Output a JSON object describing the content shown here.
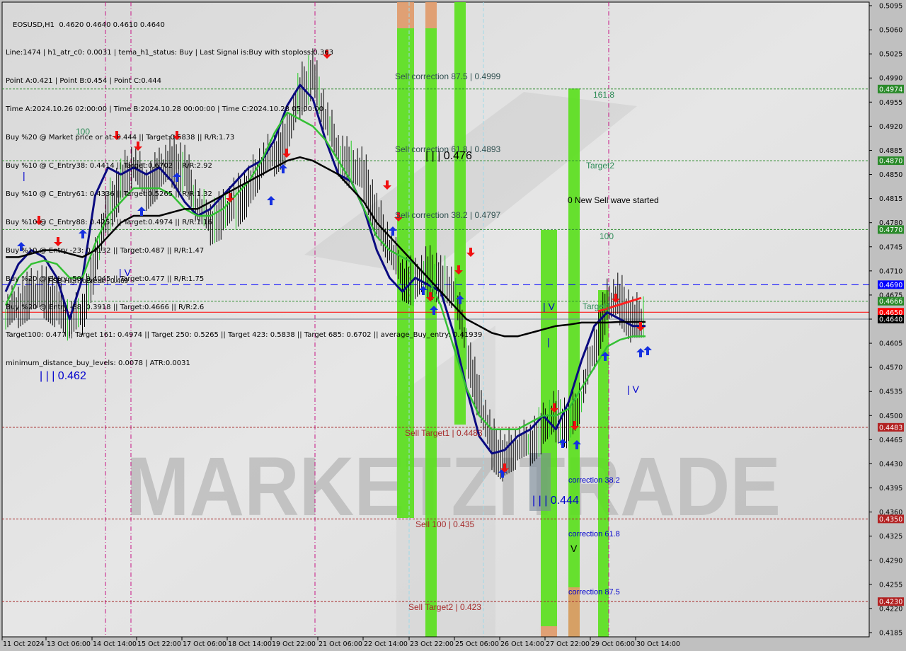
{
  "header": {
    "title": "EOSUSD,H1  0.4620 0.4640 0.4610 0.4640",
    "lines": [
      "Line:1474 | h1_atr_c0: 0.0031 | tema_h1_status: Buy | Last Signal is:Buy with stoploss:0.363",
      "Point A:0.421 | Point B:0.454 | Point C:0.444",
      "Time A:2024.10.26 02:00:00 | Time B:2024.10.28 00:00:00 | Time C:2024.10.28 05:00:00",
      "Buy %20 @ Market price or at: 0.444 || Target:0.5838 || R/R:1.73",
      "Buy %10 @ C_Entry38: 0.4414 || Target:0.6702 || R/R:2.92",
      "Buy %10 @ C_Entry61: 0.4336 || Target:0.5265 || R/R:1.32",
      "Buy %10 @ C_Entry88: 0.4251 || Target:0.4974 || R/R:1.16",
      "Buy %10 @ Entry -23: 0.4132 || Target:0.487 || R/R:1.47",
      "Buy %20 @ Entry -50: 0.4045 || Target:0.477 || R/R:1.75",
      "Buy %20 @ Entry -88: 0.3918 || Target:0.4666 || R/R:2.6",
      "Target100: 0.477 || Target 161: 0.4974 || Target 250: 0.5265 || Target 423: 0.5838 || Target 685: 0.6702 || average_Buy_entry: 0.41939",
      "minimum_distance_buy_levels: 0.0078 | ATR:0.0031"
    ]
  },
  "watermark": "MARKETZITRADE",
  "chart_data": {
    "type": "line",
    "title": "EOSUSD,H1",
    "symbol": "EOSUSD",
    "timeframe": "H1",
    "ohlc_last": {
      "open": 0.462,
      "high": 0.464,
      "low": 0.461,
      "close": 0.464
    },
    "ylim": [
      0.417,
      0.511
    ],
    "yticks": [
      "0.5095",
      "0.5060",
      "0.5025",
      "0.4990",
      "0.4955",
      "0.4920",
      "0.4885",
      "0.4850",
      "0.4815",
      "0.4780",
      "0.4745",
      "0.4710",
      "0.4675",
      "0.4640",
      "0.4605",
      "0.4570",
      "0.4535",
      "0.4500",
      "0.4465",
      "0.4430",
      "0.4395",
      "0.4360",
      "0.4325",
      "0.4290",
      "0.4255",
      "0.4220",
      "0.4185"
    ],
    "xticks": [
      "11 Oct 2024",
      "13 Oct 06:00",
      "14 Oct 14:00",
      "15 Oct 22:00",
      "17 Oct 06:00",
      "18 Oct 14:00",
      "19 Oct 22:00",
      "21 Oct 06:00",
      "22 Oct 14:00",
      "23 Oct 22:00",
      "25 Oct 06:00",
      "26 Oct 14:00",
      "27 Oct 22:00",
      "29 Oct 06:00",
      "30 Oct 14:00"
    ],
    "grid": false,
    "series": [
      {
        "name": "price-close",
        "color": "#000000",
        "values": [
          0.464,
          0.466,
          0.4675,
          0.468,
          0.4665,
          0.463,
          0.465,
          0.472,
          0.48,
          0.484,
          0.486,
          0.483,
          0.485,
          0.487,
          0.486,
          0.48,
          0.478,
          0.479,
          0.481,
          0.483,
          0.486,
          0.488,
          0.49,
          0.497,
          0.5,
          0.493,
          0.488,
          0.486,
          0.485,
          0.479,
          0.474,
          0.47,
          0.469,
          0.471,
          0.47,
          0.468,
          0.46,
          0.452,
          0.446,
          0.444,
          0.445,
          0.446,
          0.448,
          0.45,
          0.449,
          0.452,
          0.46,
          0.466,
          0.467,
          0.464,
          0.464
        ]
      },
      {
        "name": "tema-fast",
        "color": "#0a0a80",
        "values": [
          0.468,
          0.472,
          0.474,
          0.473,
          0.47,
          0.464,
          0.47,
          0.482,
          0.486,
          0.485,
          0.486,
          0.485,
          0.486,
          0.484,
          0.481,
          0.479,
          0.48,
          0.482,
          0.484,
          0.486,
          0.487,
          0.49,
          0.495,
          0.498,
          0.496,
          0.49,
          0.485,
          0.484,
          0.48,
          0.474,
          0.47,
          0.468,
          0.47,
          0.469,
          0.468,
          0.462,
          0.454,
          0.447,
          0.4445,
          0.445,
          0.447,
          0.448,
          0.45,
          0.448,
          0.452,
          0.458,
          0.463,
          0.465,
          0.464,
          0.463,
          0.463
        ]
      },
      {
        "name": "ma-green",
        "color": "#33c033",
        "values": [
          0.466,
          0.47,
          0.472,
          0.4725,
          0.472,
          0.47,
          0.47,
          0.475,
          0.479,
          0.481,
          0.483,
          0.483,
          0.483,
          0.482,
          0.48,
          0.479,
          0.479,
          0.48,
          0.482,
          0.484,
          0.487,
          0.491,
          0.494,
          0.493,
          0.492,
          0.49,
          0.487,
          0.484,
          0.48,
          0.476,
          0.474,
          0.473,
          0.472,
          0.47,
          0.466,
          0.46,
          0.454,
          0.45,
          0.448,
          0.448,
          0.448,
          0.449,
          0.45,
          0.45,
          0.451,
          0.454,
          0.457,
          0.46,
          0.461,
          0.4615,
          0.4615
        ]
      },
      {
        "name": "ma-black",
        "color": "#000000",
        "values": [
          0.473,
          0.473,
          0.4735,
          0.474,
          0.474,
          0.4735,
          0.473,
          0.474,
          0.476,
          0.478,
          0.479,
          0.479,
          0.479,
          0.4795,
          0.48,
          0.48,
          0.481,
          0.482,
          0.483,
          0.484,
          0.485,
          0.486,
          0.487,
          0.4875,
          0.487,
          0.486,
          0.485,
          0.483,
          0.481,
          0.478,
          0.476,
          0.474,
          0.472,
          0.47,
          0.468,
          0.466,
          0.464,
          0.463,
          0.462,
          0.4615,
          0.4615,
          0.462,
          0.4625,
          0.463,
          0.4632,
          0.4635,
          0.4635,
          0.4635,
          0.4636,
          0.4636,
          0.4636
        ]
      }
    ],
    "levels": [
      {
        "label": "0.4974",
        "value": 0.4974,
        "color": "#2e8b2e",
        "style": "dotted"
      },
      {
        "label": "0.4870",
        "value": 0.487,
        "color": "#2e8b2e",
        "style": "dotted"
      },
      {
        "label": "0.4770",
        "value": 0.477,
        "color": "#2e8b2e",
        "style": "dotted"
      },
      {
        "label": "0.4690",
        "value": 0.469,
        "color": "#0000ff",
        "style": "dashed"
      },
      {
        "label": "0.4666",
        "value": 0.4666,
        "color": "#2e8b2e",
        "style": "dotted"
      },
      {
        "label": "0.4650",
        "value": 0.465,
        "color": "#ff0000",
        "style": "solid"
      },
      {
        "label": "0.4640",
        "value": 0.464,
        "color": "#708090",
        "style": "solid",
        "tag_bg": "#000000"
      },
      {
        "label": "0.4483",
        "value": 0.4483,
        "color": "#a52a2a",
        "style": "dotted"
      },
      {
        "label": "0.4350",
        "value": 0.435,
        "color": "#a52a2a",
        "style": "dotted"
      },
      {
        "label": "0.4230",
        "value": 0.423,
        "color": "#a52a2a",
        "style": "dotted"
      }
    ],
    "annotations": [
      {
        "text": "Sell correction 87.5 | 0.4999",
        "color": "#2f4f4f"
      },
      {
        "text": "Sell correction 61.8 | 0.4893",
        "color": "#2f4f4f"
      },
      {
        "text": "Sell correction 38.2 | 0.4797",
        "color": "#2f4f4f"
      },
      {
        "text": "| | | 0.476",
        "color": "#000000"
      },
      {
        "text": "161.8",
        "color": "#2e8b57"
      },
      {
        "text": "Target2",
        "color": "#2e8b57"
      },
      {
        "text": "0 New Sell wave started",
        "color": "#000000"
      },
      {
        "text": "100",
        "color": "#2e8b57"
      },
      {
        "text": "100",
        "color": "#2e8b57"
      },
      {
        "text": "Target1",
        "color": "#2e8b57"
      },
      {
        "text": "FSB-HighToBreak | 0.469",
        "color": "#000000"
      },
      {
        "text": "| | | 0.462",
        "color": "#0000cd"
      },
      {
        "text": "| V",
        "color": "#0000cd"
      },
      {
        "text": "| V",
        "color": "#0000cd"
      },
      {
        "text": "| V",
        "color": "#0000cd"
      },
      {
        "text": "|",
        "color": "#0000cd"
      },
      {
        "text": "|",
        "color": "#0000cd"
      },
      {
        "text": "Sell Target1 | 0.4483",
        "color": "#a52a2a"
      },
      {
        "text": "Sell 100 | 0.435",
        "color": "#a52a2a"
      },
      {
        "text": "Sell Target2 | 0.423",
        "color": "#a52a2a"
      },
      {
        "text": "| | | 0.444",
        "color": "#0000cd"
      },
      {
        "text": "correction 38.2",
        "color": "#0000cd"
      },
      {
        "text": "correction 61.8",
        "color": "#0000cd"
      },
      {
        "text": "correction 87.5",
        "color": "#0000cd"
      },
      {
        "text": "V",
        "color": "#000000"
      }
    ]
  },
  "colors": {
    "background": "#dcdcdc",
    "axis_bg": "#c0c0c0",
    "zone_green": "#5be01e",
    "zone_orange": "#e09a6a",
    "zone_gray": "#7a8a9a",
    "magenta_line": "#c71585",
    "cyan_line": "#9fd9e8"
  }
}
